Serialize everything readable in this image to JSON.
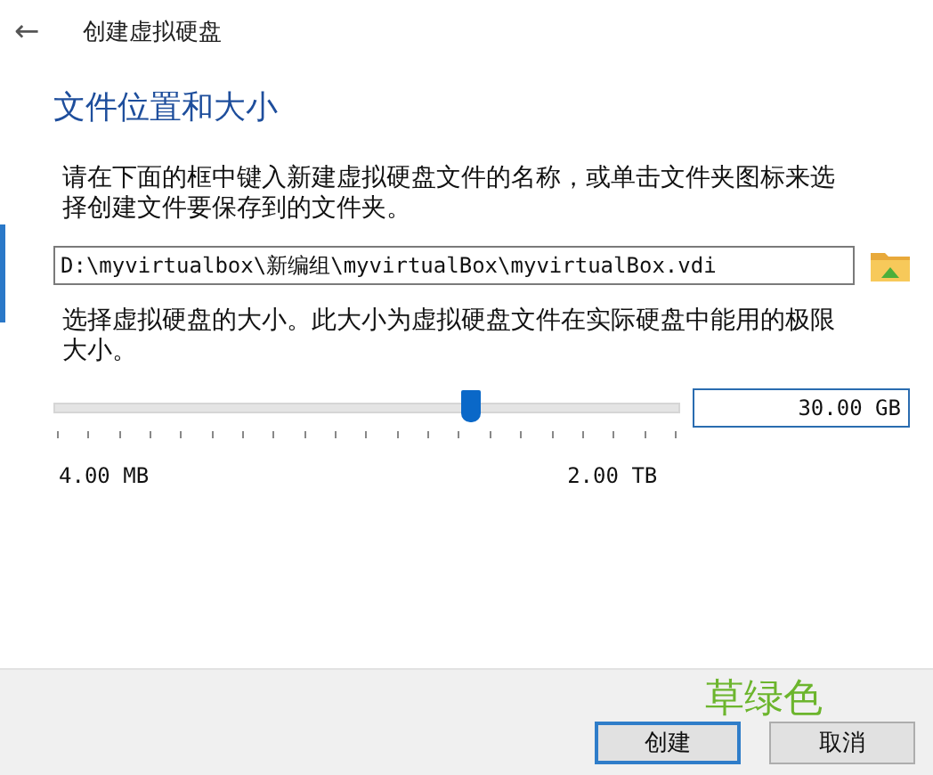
{
  "window": {
    "title": "创建虚拟硬盘",
    "back_icon": "←"
  },
  "page": {
    "heading": "文件位置和大小",
    "intro": "请在下面的框中键入新建虚拟硬盘文件的名称，或单击文件夹图标来选择创建文件要保存到的文件夹。"
  },
  "file_path": {
    "value": "D:\\myvirtualbox\\新编组\\myvirtualBox\\myvirtualBox.vdi"
  },
  "size": {
    "description": "选择虚拟硬盘的大小。此大小为虚拟硬盘文件在实际硬盘中能用的极限大小。",
    "level": 0.667,
    "value": "30.00 GB",
    "min_label": "4.00 MB",
    "max_label": "2.00 TB"
  },
  "buttons": [
    {
      "label": "创建",
      "default": true
    },
    {
      "label": "取消",
      "default": false
    }
  ],
  "annotation": {
    "text": "草绿色",
    "color": "#6cb52d"
  }
}
